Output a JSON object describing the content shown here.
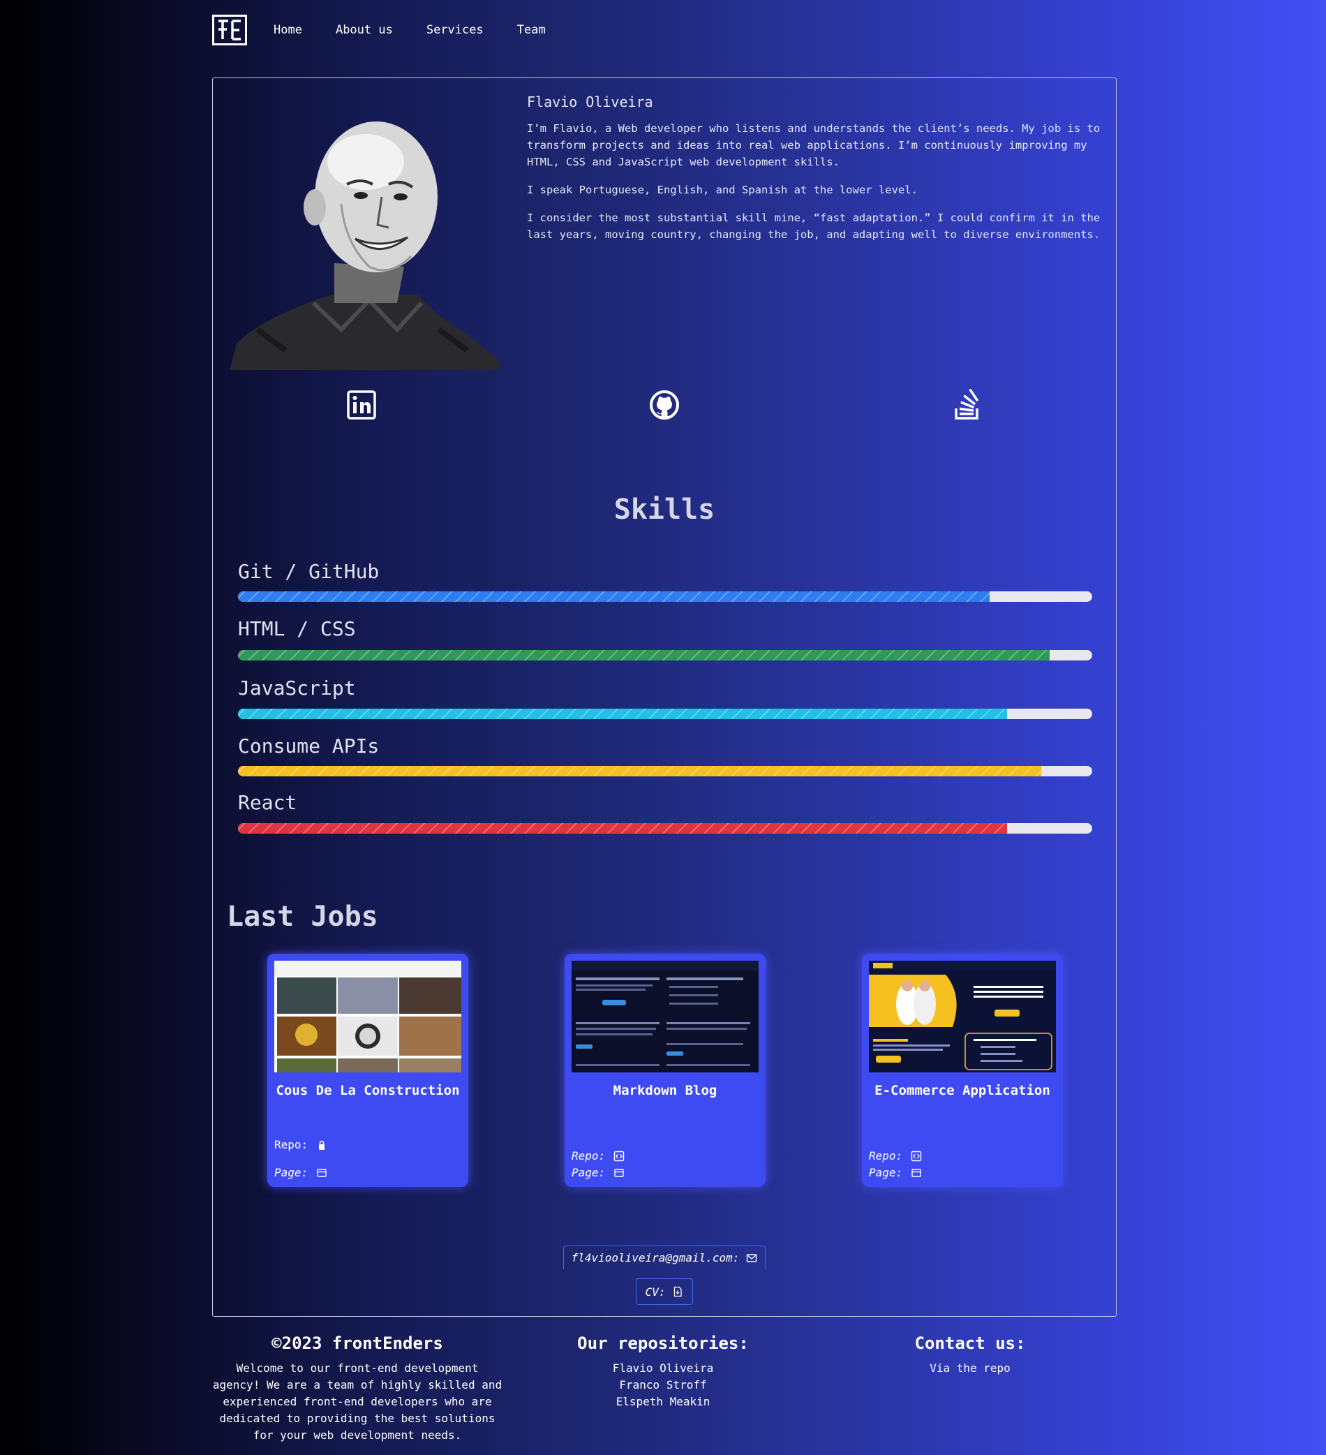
{
  "nav": {
    "logo_alt": "FE",
    "links": [
      "Home",
      "About us",
      "Services",
      "Team"
    ]
  },
  "profile": {
    "name": "Flavio Oliveira",
    "paragraphs": [
      "I’m Flavio, a Web developer who listens and understands the client’s needs. My job is to transform projects and ideas into real web applications. I’m continuously improving my HTML, CSS and JavaScript web development skills.",
      "I speak Portuguese, English, and Spanish at the lower level.",
      "I consider the most substantial skill mine, “fast adaptation.” I could confirm it in the last years, moving country, changing the job, and adapting well to diverse environments."
    ],
    "socials": [
      "linkedin-icon",
      "github-icon",
      "stackoverflow-icon"
    ]
  },
  "skills": {
    "title": "Skills",
    "items": [
      {
        "label": "Git / GitHub",
        "level": 88,
        "color": "#2f7df0"
      },
      {
        "label": "HTML / CSS",
        "level": 95,
        "color": "#2e9a5a"
      },
      {
        "label": "JavaScript",
        "level": 90,
        "color": "#1fc2e6"
      },
      {
        "label": "Consume APIs",
        "level": 94,
        "color": "#f5c020"
      },
      {
        "label": "React",
        "level": 90,
        "color": "#e0353f"
      }
    ]
  },
  "jobs": {
    "title": "Last Jobs",
    "items": [
      {
        "title": "Cous De La Construction",
        "repo_label": "Repo:",
        "page_label": "Page:",
        "repo_icon": "lock-icon",
        "page_icon": "browser-icon"
      },
      {
        "title": "Markdown Blog",
        "repo_label": "Repo:",
        "page_label": "Page:",
        "repo_icon": "code-icon",
        "page_icon": "browser-icon"
      },
      {
        "title": "E-Commerce Application",
        "repo_label": "Repo:",
        "page_label": "Page:",
        "repo_icon": "code-icon",
        "page_icon": "browser-icon"
      }
    ]
  },
  "contact": {
    "email": "fl4viooliveira@gmail.com:",
    "cv": "CV:"
  },
  "footer": {
    "brand": "©2023 frontEnders",
    "description": "Welcome to our front-end development agency! We are a team of highly skilled and experienced front-end developers who are dedicated to providing the best solutions for your web development needs.",
    "repos_title": "Our repositories:",
    "repos": [
      "Flavio Oliveira",
      "Franco Stroff",
      "Elspeth Meakin"
    ],
    "contact_title": "Contact us:",
    "contact_text": "Via the repo"
  }
}
